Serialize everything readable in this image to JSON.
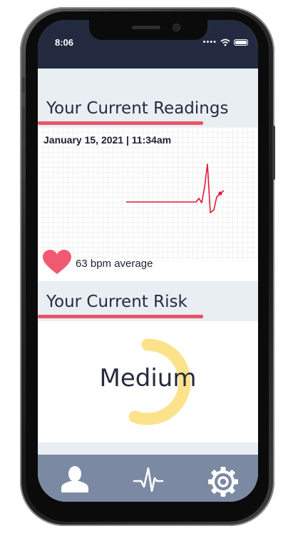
{
  "status_bar": {
    "time": "8:06"
  },
  "readings": {
    "title": "Your Current Readings",
    "datetime": "January 15, 2021 | 11:34am",
    "bpm_average": "63 bpm average"
  },
  "risk": {
    "title": "Your Current Risk",
    "level": "Medium",
    "gauge_fraction": 0.5
  },
  "tab_bar": {
    "tabs": [
      {
        "icon": "person-icon"
      },
      {
        "icon": "heartbeat-icon"
      },
      {
        "icon": "gear-icon"
      }
    ]
  },
  "colors": {
    "accent": "#e8556a",
    "header_dark": "#232a40",
    "tab_bar": "#7b89a3",
    "gauge": "#fce28a",
    "text": "#262b3e"
  }
}
